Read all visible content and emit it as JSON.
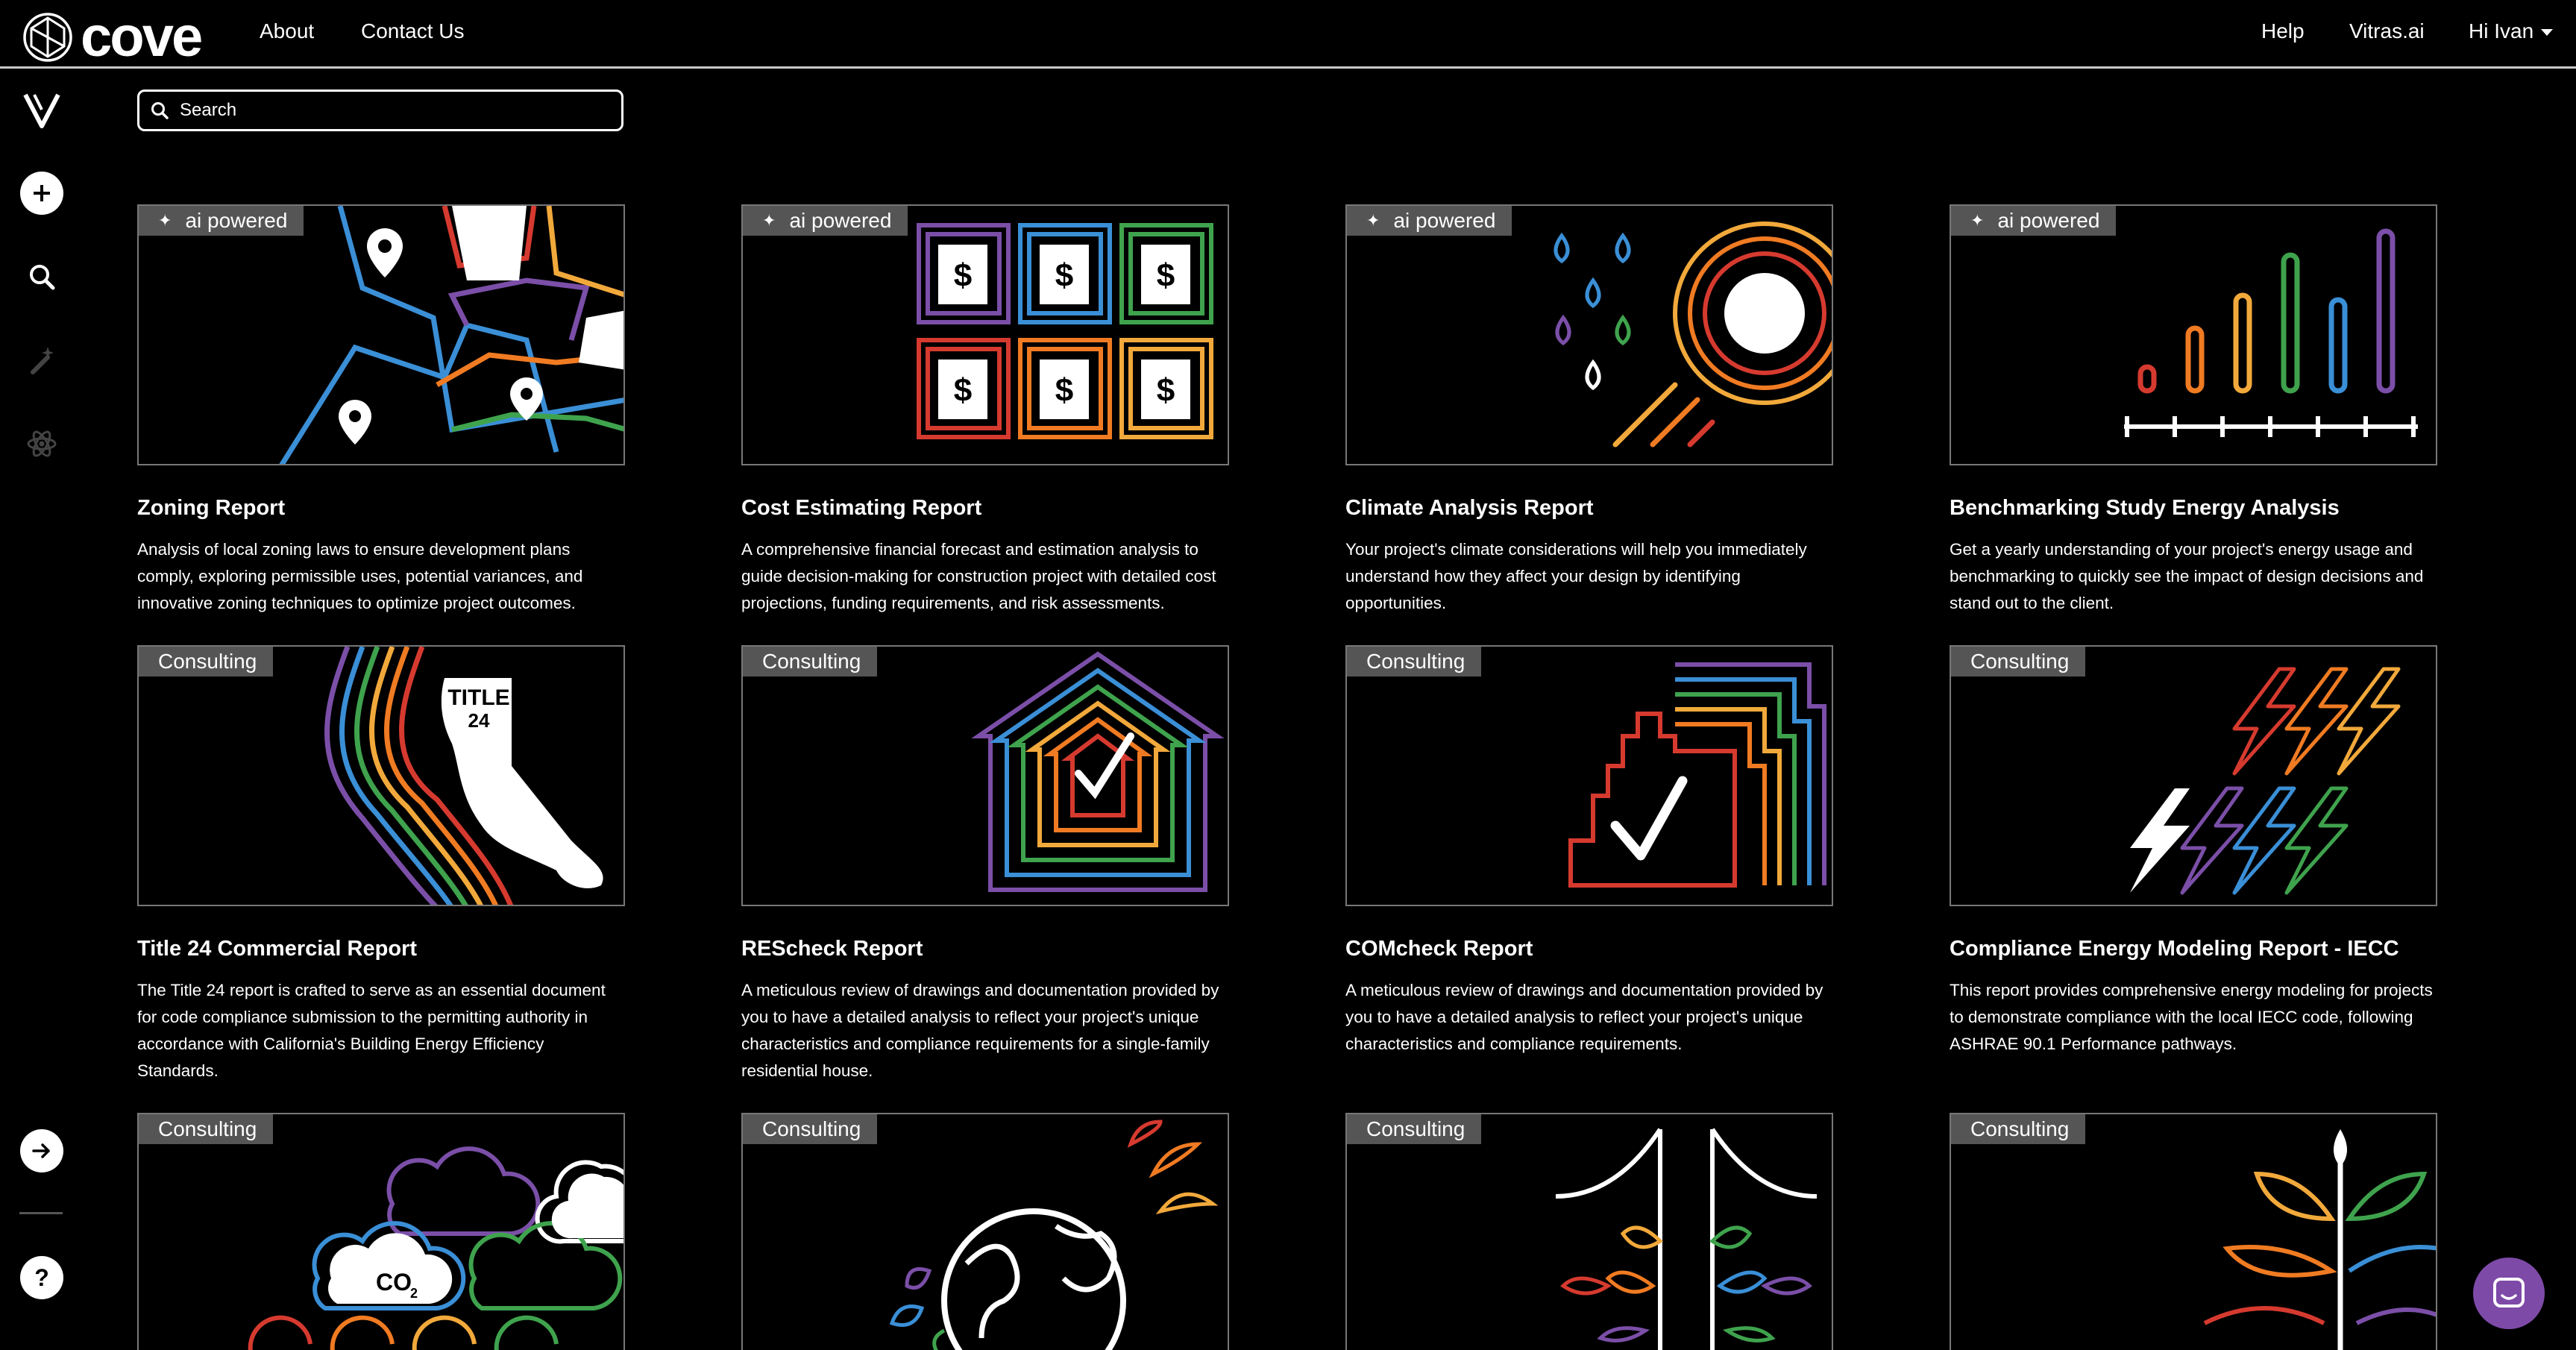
{
  "brand": {
    "name": "cove"
  },
  "nav": {
    "about": "About",
    "contact": "Contact Us",
    "help": "Help",
    "vitras": "Vitras.ai",
    "user": "Hi Ivan"
  },
  "search": {
    "placeholder": "Search"
  },
  "rail": {
    "icons": [
      "vitras-v-icon",
      "add-icon",
      "search-icon",
      "magic-wand-icon",
      "atom-icon",
      "arrow-right-icon",
      "help-icon"
    ]
  },
  "cards": [
    {
      "badge": "ai powered",
      "title": "Zoning Report",
      "desc": "Analysis of local zoning laws to ensure development plans comply, exploring permissible uses, potential variances, and innovative zoning techniques to optimize project outcomes."
    },
    {
      "badge": "ai powered",
      "title": "Cost Estimating Report",
      "desc": "A comprehensive financial forecast and estimation analysis to guide decision-making for construction project with detailed cost projections, funding requirements, and risk assessments."
    },
    {
      "badge": "ai powered",
      "title": "Climate Analysis Report",
      "desc": "Your project's climate considerations will help you immediately understand how they affect your design by identifying opportunities."
    },
    {
      "badge": "ai powered",
      "title": "Benchmarking Study Energy Analysis",
      "desc": "Get a yearly understanding of your project's energy usage and benchmarking to quickly see the impact of design decisions and stand out to the client."
    },
    {
      "badge": "Consulting",
      "title": "Title 24 Commercial Report",
      "desc": "The Title 24 report is crafted to serve as an essential document for code compliance submission to the permitting authority in accordance with California's Building Energy Efficiency Standards.",
      "art_text_1": "TITLE",
      "art_text_2": "24"
    },
    {
      "badge": "Consulting",
      "title": "REScheck Report",
      "desc": "A meticulous review of drawings and documentation provided by you to have a detailed analysis to reflect your project's unique characteristics and compliance requirements for a single-family residential house."
    },
    {
      "badge": "Consulting",
      "title": "COMcheck Report",
      "desc": "A meticulous review of drawings and documentation provided by you to have a detailed analysis to reflect your project's unique characteristics and compliance requirements."
    },
    {
      "badge": "Consulting",
      "title": "Compliance Energy Modeling Report - IECC",
      "desc": "This report provides comprehensive energy modeling for projects to demonstrate compliance with the local IECC code, following ASHRAE 90.1 Performance pathways."
    },
    {
      "badge": "Consulting",
      "art_text": "CO",
      "art_sub": "2"
    },
    {
      "badge": "Consulting"
    },
    {
      "badge": "Consulting"
    },
    {
      "badge": "Consulting"
    }
  ],
  "colors": {
    "red": "#d63a2f",
    "orange": "#f07b22",
    "yellow": "#f2a93b",
    "green": "#3fa34d",
    "blue": "#3a8fd6",
    "purple": "#7b4fa8",
    "chat": "#7e4aa8",
    "badge": "#555555"
  }
}
